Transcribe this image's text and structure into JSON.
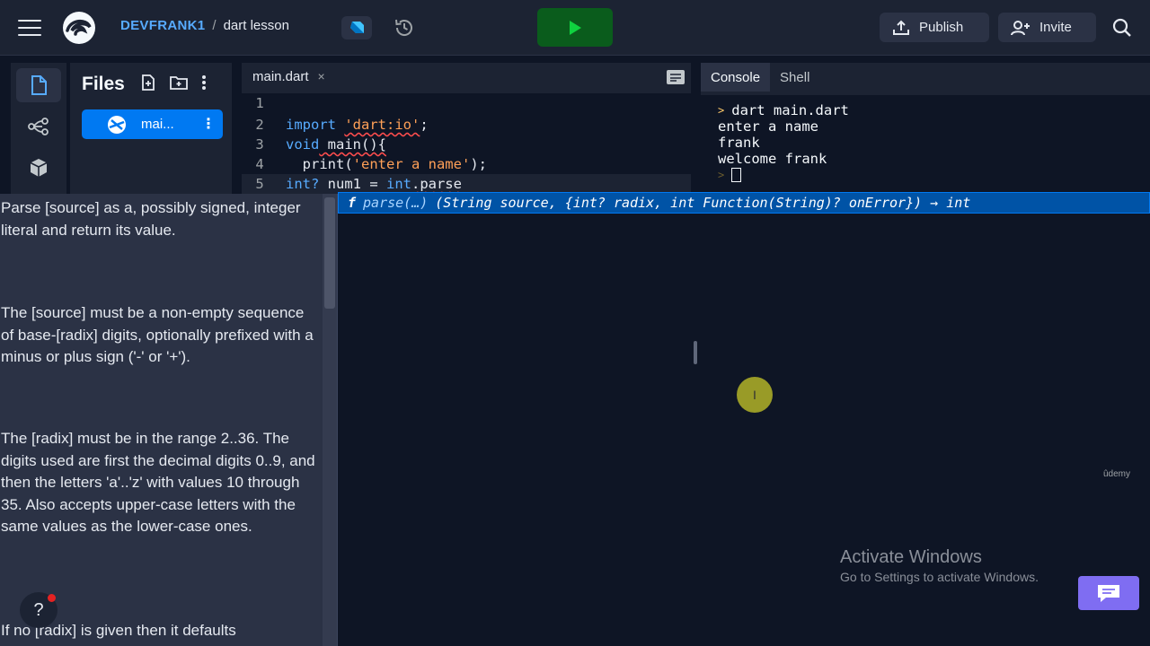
{
  "topbar": {
    "user": "DEVFRANK1",
    "separator": "/",
    "project": "dart lesson",
    "publish_label": "Publish",
    "invite_label": "Invite"
  },
  "files": {
    "title": "Files",
    "items": [
      {
        "label": "mai..."
      }
    ]
  },
  "editor": {
    "tab_label": "main.dart",
    "tab_close": "×",
    "lines": [
      {
        "num": "1"
      },
      {
        "num": "2"
      },
      {
        "num": "3"
      },
      {
        "num": "4"
      },
      {
        "num": "5"
      }
    ],
    "code": {
      "l2_kw": "import",
      "l2_str": "'dart:io'",
      "l2_end": ";",
      "l3_kw": "void",
      "l3_rest": " main(){",
      "l4_fn": "  print(",
      "l4_str": "'enter a name'",
      "l4_end": ");",
      "l5_kw": "int?",
      "l5_mid": " num1 = ",
      "l5_kw2": "int",
      "l5_end": ".parse"
    }
  },
  "autocomplete": {
    "kind": "f",
    "name": "parse(…)",
    "signature": "(String source, {int? radix, int Function(String)? onError}) → int"
  },
  "doc": {
    "paragraphs": [
      "Parse [source] as a, possibly signed, integer literal and return its value.",
      "The [source] must be a non-empty sequence of base-[radix] digits, optionally prefixed with a minus or plus sign ('-' or '+').",
      "The [radix] must be in the range 2..36. The digits used are first the decimal digits 0..9, and then the letters 'a'..'z' with values 10 through 35. Also accepts upper-case letters with the same values as the lower-case ones.",
      "If no [radix] is given then it defaults"
    ],
    "help": "?"
  },
  "console": {
    "tabs": [
      {
        "label": "Console"
      },
      {
        "label": "Shell"
      }
    ],
    "lines": [
      {
        "text": "dart main.dart"
      },
      {
        "text": "enter a name"
      },
      {
        "text": "frank"
      },
      {
        "text": "welcome frank"
      }
    ],
    "prompt_glyph": ">",
    "watermark": "ûdemy",
    "activate_title": "Activate Windows",
    "activate_sub": "Go to Settings to activate Windows."
  }
}
